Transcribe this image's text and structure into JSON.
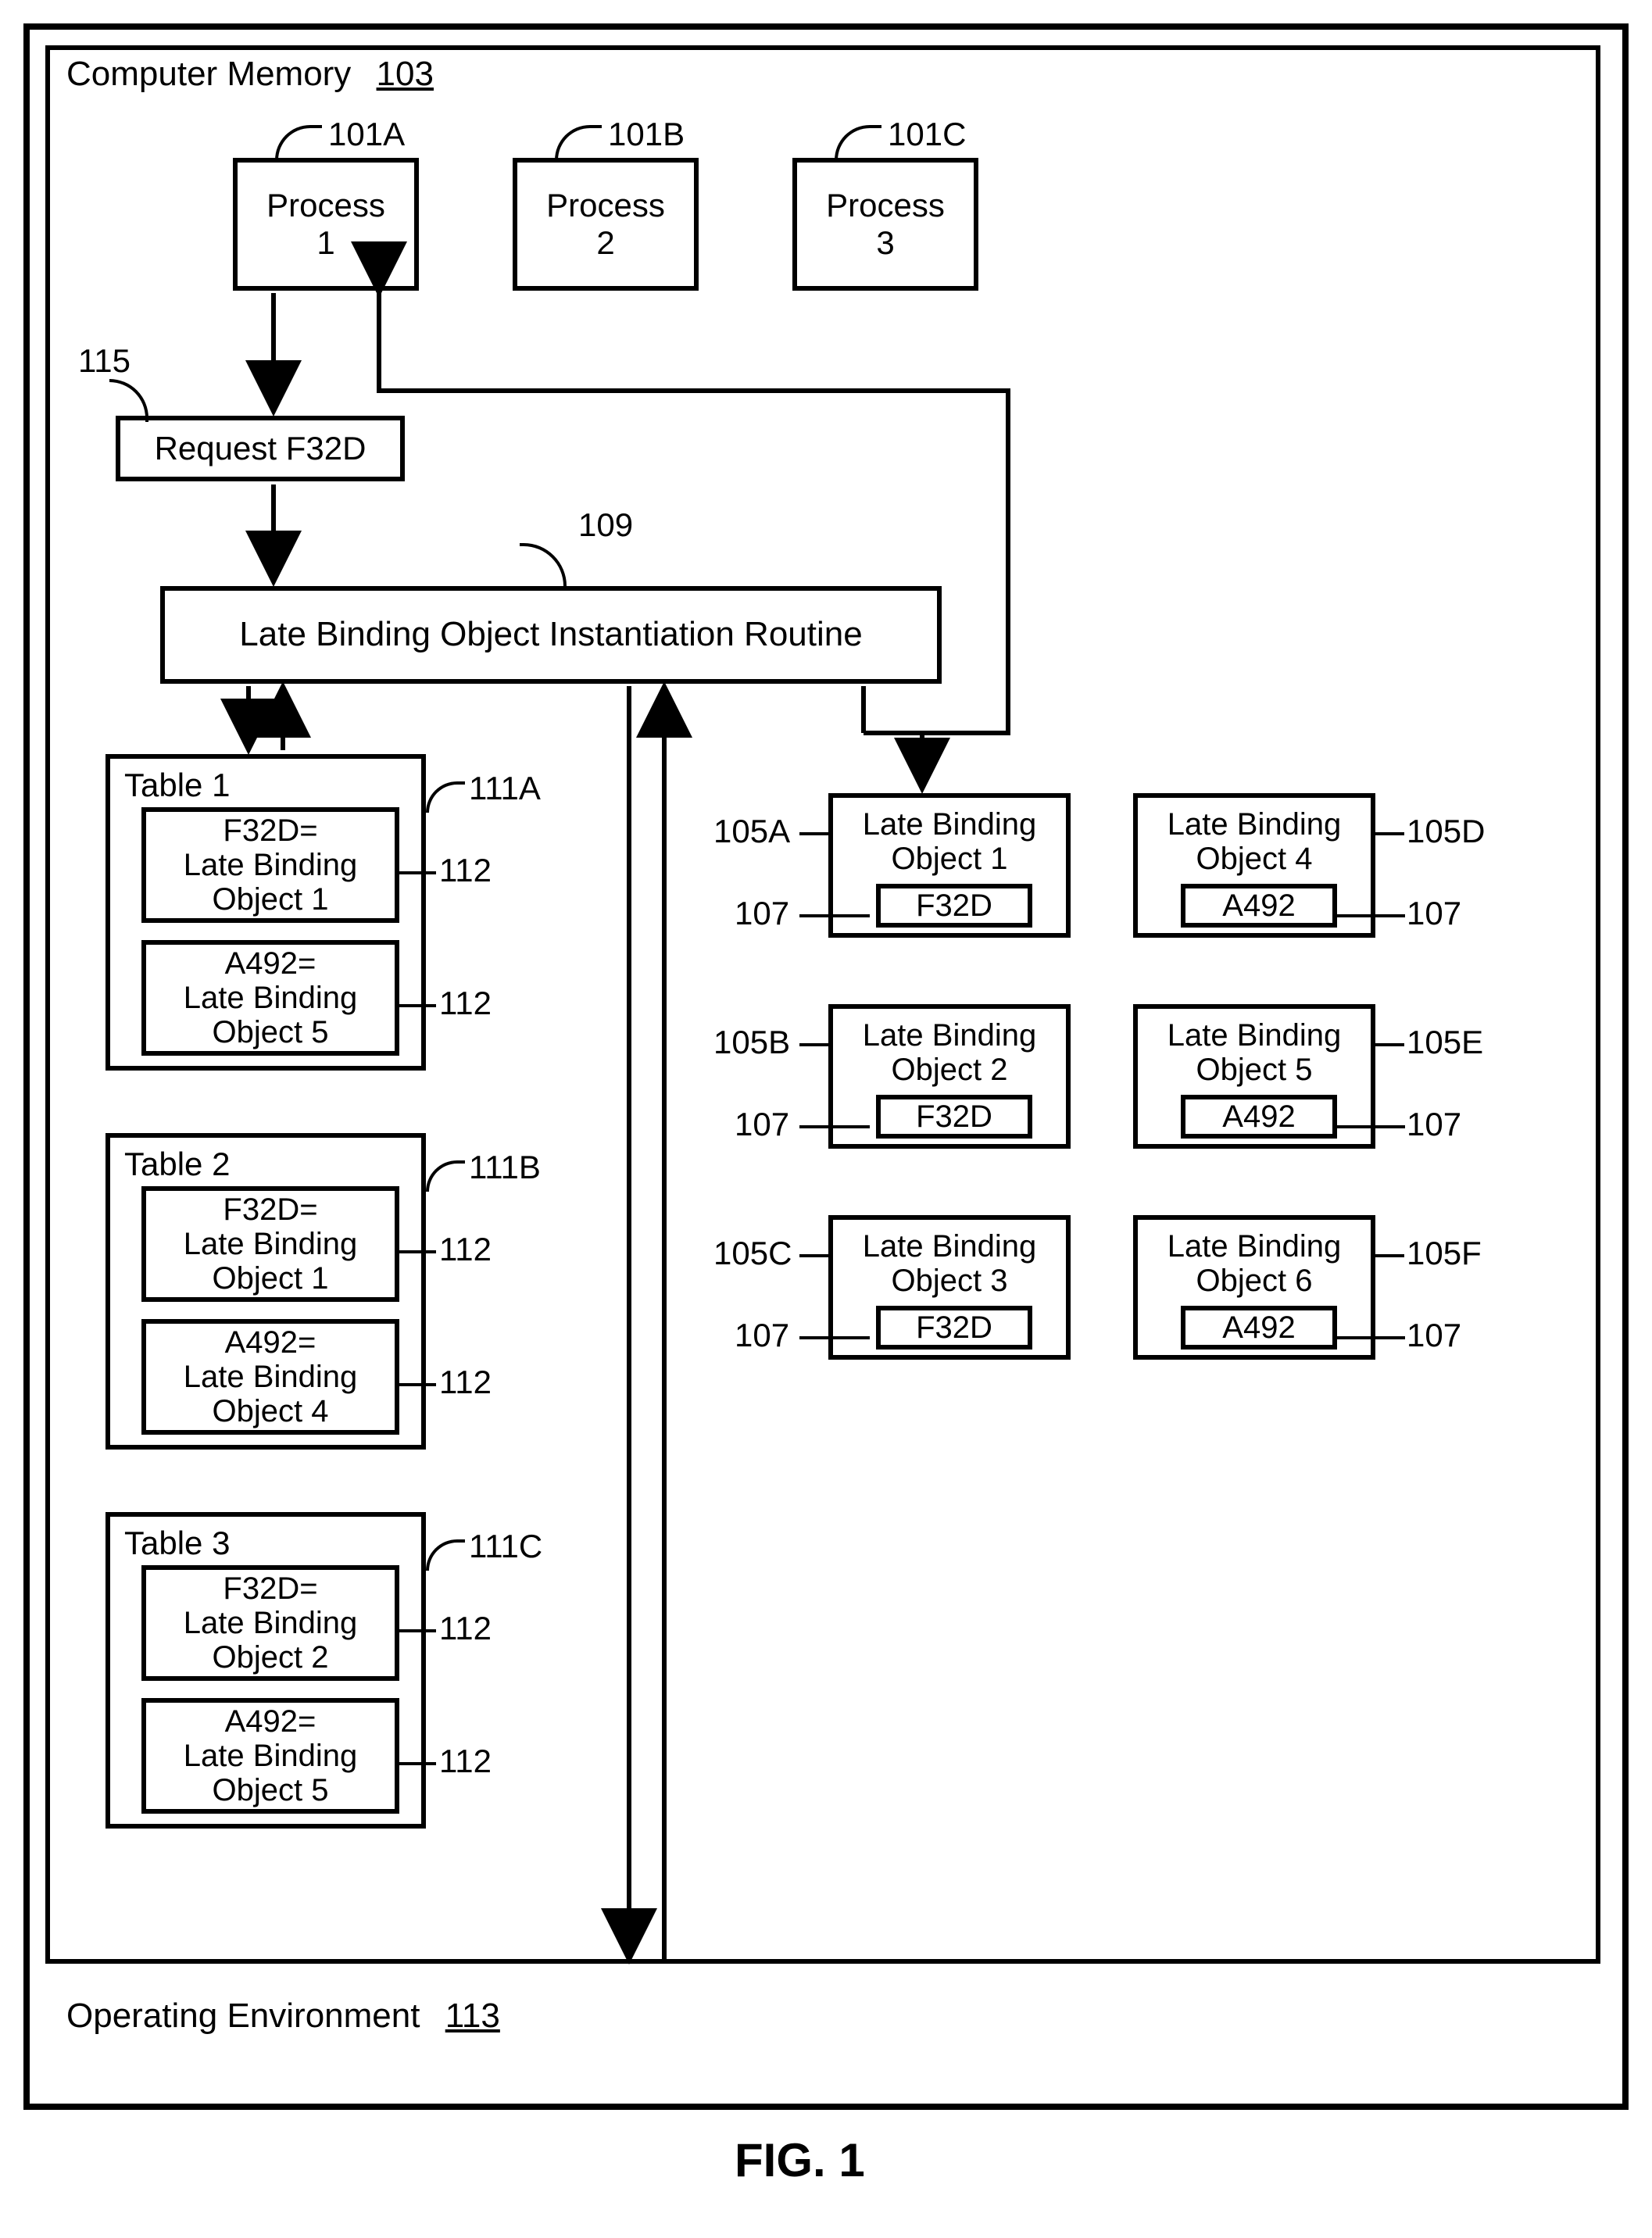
{
  "figureCaption": "FIG. 1",
  "memory": {
    "title": "Computer Memory",
    "ref": "103"
  },
  "processes": [
    {
      "label": "Process\n1",
      "ref": "101A"
    },
    {
      "label": "Process\n2",
      "ref": "101B"
    },
    {
      "label": "Process\n3",
      "ref": "101C"
    }
  ],
  "request": {
    "label": "Request F32D",
    "ref": "115"
  },
  "routine": {
    "label": "Late Binding Object Instantiation Routine",
    "ref": "109"
  },
  "tables": [
    {
      "title": "Table 1",
      "ref": "111A",
      "entries": [
        {
          "text": "F32D=\nLate Binding\nObject 1",
          "ref": "112"
        },
        {
          "text": "A492=\nLate Binding\nObject 5",
          "ref": "112"
        }
      ]
    },
    {
      "title": "Table 2",
      "ref": "111B",
      "entries": [
        {
          "text": "F32D=\nLate Binding\nObject 1",
          "ref": "112"
        },
        {
          "text": "A492=\nLate Binding\nObject 4",
          "ref": "112"
        }
      ]
    },
    {
      "title": "Table 3",
      "ref": "111C",
      "entries": [
        {
          "text": "F32D=\nLate Binding\nObject 2",
          "ref": "112"
        },
        {
          "text": "A492=\nLate Binding\nObject 5",
          "ref": "112"
        }
      ]
    }
  ],
  "lbos": [
    {
      "title": "Late Binding\nObject 1",
      "code": "F32D",
      "ref": "105A",
      "coderef": "107"
    },
    {
      "title": "Late Binding\nObject 2",
      "code": "F32D",
      "ref": "105B",
      "coderef": "107"
    },
    {
      "title": "Late Binding\nObject 3",
      "code": "F32D",
      "ref": "105C",
      "coderef": "107"
    },
    {
      "title": "Late Binding\nObject 4",
      "code": "A492",
      "ref": "105D",
      "coderef": "107"
    },
    {
      "title": "Late Binding\nObject 5",
      "code": "A492",
      "ref": "105E",
      "coderef": "107"
    },
    {
      "title": "Late Binding\nObject 6",
      "code": "A492",
      "ref": "105F",
      "coderef": "107"
    }
  ],
  "env": {
    "title": "Operating Environment",
    "ref": "113"
  }
}
